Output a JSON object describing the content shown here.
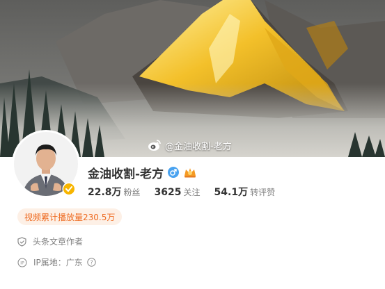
{
  "cover": {
    "watermark_text": "@金油收割-老方",
    "watermark_icon": "weibo-logo-icon",
    "sky_color": "#5a5a58",
    "mountain_gold": "#f0b820"
  },
  "profile": {
    "avatar_icon": "user-avatar",
    "verify_badge_icon": "verified-badge-icon",
    "verify_color": "#f7b500",
    "name": "金油收割-老方",
    "gender_icon": "male-icon",
    "gender_color": "#4aa3f0",
    "member_icon": "crown-icon",
    "stats": [
      {
        "value": "22.8万",
        "label": "粉丝"
      },
      {
        "value": "3625",
        "label": "关注"
      },
      {
        "value": "54.1万",
        "label": "转评赞"
      }
    ]
  },
  "badge": {
    "text": "视频累计播放量230.5万",
    "text_color": "#ee6a20",
    "bg_color": "#fdf0e6"
  },
  "info": {
    "role": {
      "icon": "shield-check-icon",
      "text": "头条文章作者"
    },
    "ip": {
      "icon": "ip-location-icon",
      "text": "IP属地：广东",
      "help_icon": "question-mark-icon"
    }
  }
}
